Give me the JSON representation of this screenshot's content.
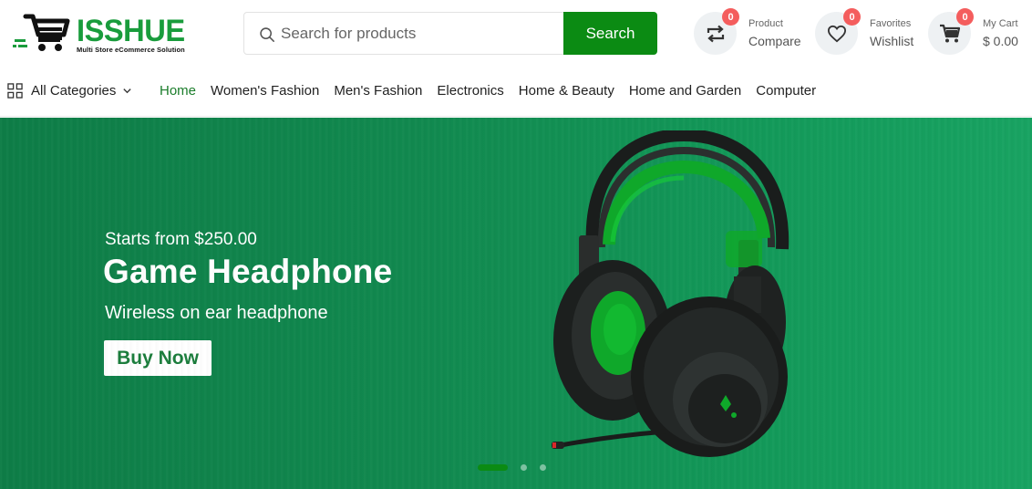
{
  "brand": {
    "name": "ISSHUE",
    "tagline": "Multi Store eCommerce Solution",
    "color": "#199c3c"
  },
  "search": {
    "placeholder": "Search for products",
    "value": "",
    "button_label": "Search",
    "button_color": "#0b8b13"
  },
  "header_actions": {
    "compare": {
      "icon": "compare-arrows-icon",
      "badge": "0",
      "small": "Product",
      "big": "Compare"
    },
    "wishlist": {
      "icon": "heart-icon",
      "badge": "0",
      "small": "Favorites",
      "big": "Wishlist"
    },
    "cart": {
      "icon": "cart-icon",
      "badge": "0",
      "small": "My Cart",
      "big": "$ 0.00"
    }
  },
  "nav": {
    "categories_label": "All Categories",
    "items": [
      {
        "label": "Home",
        "active": true
      },
      {
        "label": "Women's Fashion",
        "active": false
      },
      {
        "label": "Men's Fashion",
        "active": false
      },
      {
        "label": "Electronics",
        "active": false
      },
      {
        "label": "Home & Beauty",
        "active": false
      },
      {
        "label": "Home and Garden",
        "active": false
      },
      {
        "label": "Computer",
        "active": false
      }
    ]
  },
  "hero": {
    "subtitle": "Starts from $250.00",
    "title": "Game Headphone",
    "description": "Wireless on ear headphone",
    "cta": "Buy Now",
    "background_color": "#11894f",
    "slides": 3,
    "active_slide": 1
  }
}
